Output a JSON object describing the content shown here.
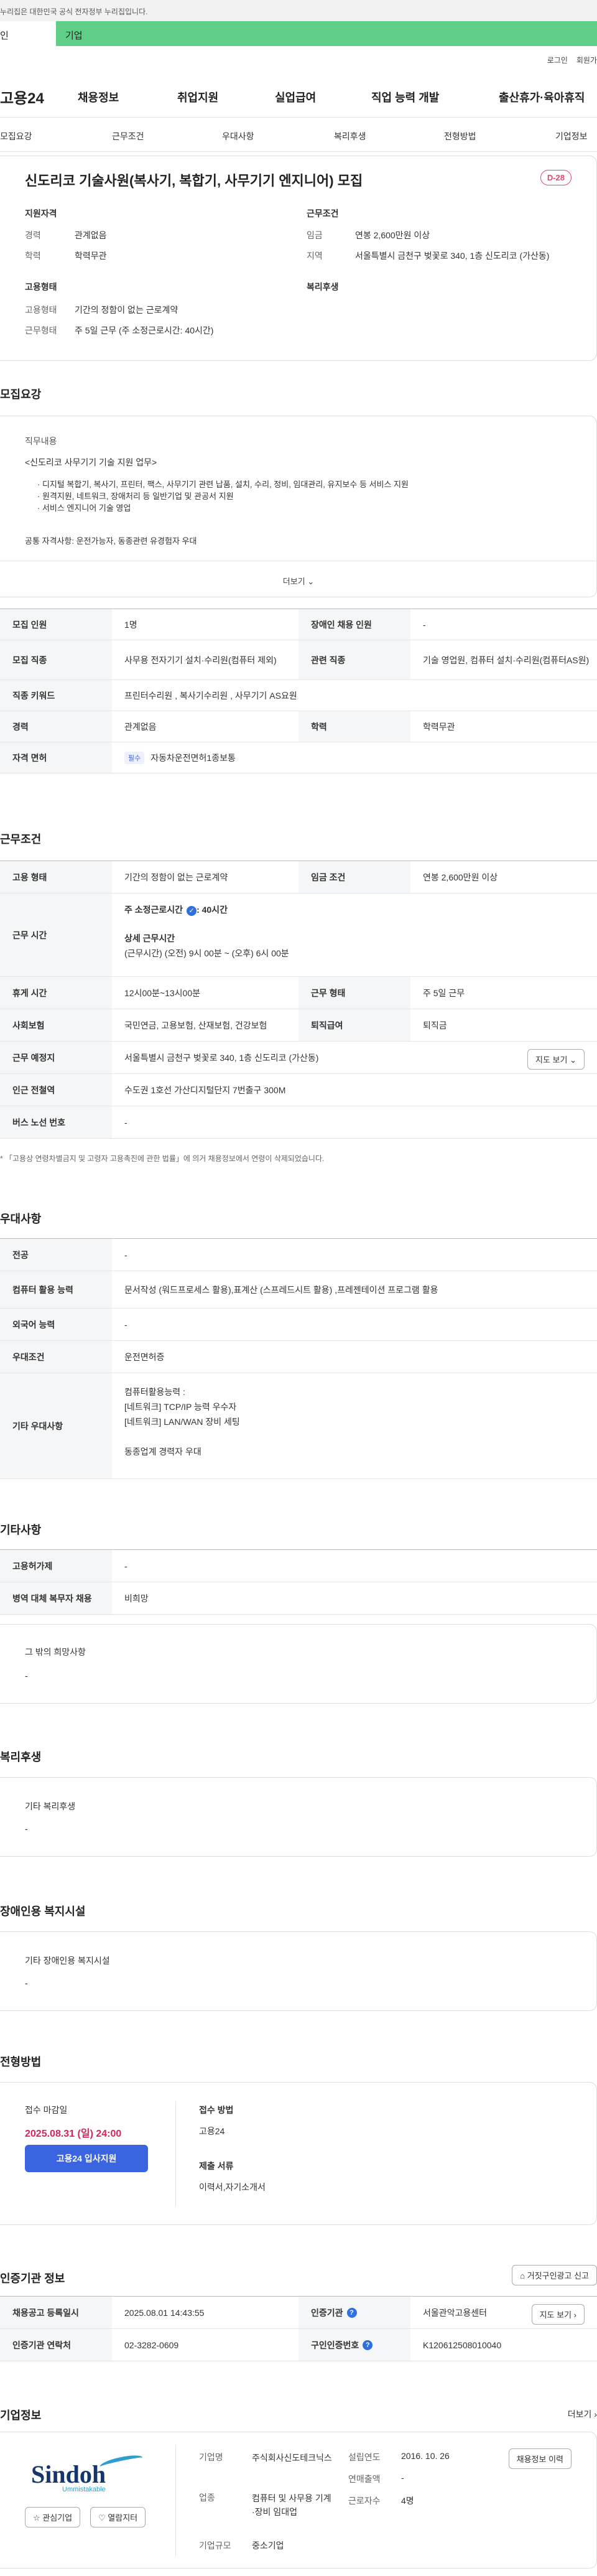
{
  "gov_banner": {
    "text": "누리집은 대한민국 공식 전자정부 누리집입니다."
  },
  "mode_tabs": {
    "person": "인",
    "corp": "기업"
  },
  "util_links": [
    "로그인",
    "회원가"
  ],
  "logo": "고용24",
  "gnb": [
    "채용정보",
    "취업지원",
    "실업급여",
    "직업 능력 개발",
    "출산휴가·육아휴직"
  ],
  "sub_nav": [
    "모집요강",
    "근무조건",
    "우대사항",
    "복리후생",
    "전형방법",
    "기업정보"
  ],
  "job": {
    "title": "신도리코 기술사원(복사기, 복합기, 사무기기 엔지니어) 모집",
    "dday": "D-28",
    "summary": {
      "qualification_title": "지원자격",
      "career_key": "경력",
      "career_val": "관계없음",
      "edu_key": "학력",
      "edu_val": "학력무관",
      "employment_title": "고용형태",
      "emp_type_key": "고용형태",
      "emp_type_val": "기간의 정함이 없는 근로계약",
      "work_type_key": "근무형태",
      "work_type_val": "주 5일 근무 (주 소정근로시간: 40시간)",
      "conditions_title": "근무조건",
      "wage_key": "임금",
      "wage_val": "연봉 2,600만원 이상",
      "region_key": "지역",
      "region_val": "서울특별시 금천구 벚꽃로 340, 1층 신도리코 (가산동)",
      "welfare_title": "복리후생"
    }
  },
  "recruit": {
    "section_title": "모집요강",
    "duty_label": "직무내용",
    "duty_header": "<신도리코 사무기기 기술 지원 업무>",
    "duty_items": [
      "· 디지털 복합기, 복사기, 프린터, 팩스, 사무기기 관련 납품, 설치, 수리, 정비, 임대관리, 유지보수 등 서비스 지원",
      "· 원격지원, 네트워크, 장애처리 등 일반기업 및 관공서 지원",
      "· 서비스 엔지니어 기술 영업"
    ],
    "duty_extra": "공통 자격사항: 운전가능자, 동종관련 유경험자 우대",
    "more_label": "더보기",
    "rows": {
      "headcount_key": "모집 인원",
      "headcount_val": "1명",
      "disabled_key": "장애인 채용 인원",
      "disabled_val": "-",
      "job_key": "모집 직종",
      "job_val": "사무용 전자기기 설치·수리원(컴퓨터 제외)",
      "related_key": "관련 직종",
      "related_val": "기술 영업원, 컴퓨터 설치·수리원(컴퓨터AS원)",
      "keyword_key": "직종 키워드",
      "keyword_val": "프린터수리원 , 복사기수리원 , 사무기기 AS요원",
      "career_key": "경력",
      "career_val": "관계없음",
      "edu_key": "학력",
      "edu_val": "학력무관",
      "license_key": "자격 면허",
      "license_badge": "필수",
      "license_val": "자동차운전면허1종보통"
    }
  },
  "conditions": {
    "section_title": "근무조건",
    "emp_key": "고용 형태",
    "emp_val": "기간의 정함이 없는 근로계약",
    "wage_key": "임금 조건",
    "wage_val": "연봉 2,600만원 이상",
    "hours_key": "근무 시간",
    "hours_line1": "주 소정근로시간",
    "hours_line1b": ": 40시간",
    "hours_detail_title": "상세 근무시간",
    "hours_detail": "(근무시간) (오전) 9시 00분 ~ (오후) 6시 00분",
    "break_key": "휴게 시간",
    "break_val": "12시00분~13시00분",
    "worktype_key": "근무 형태",
    "worktype_val": "주 5일 근무",
    "insurance_key": "사회보험",
    "insurance_val": "국민연금, 고용보험, 산재보험, 건강보험",
    "retire_key": "퇴직급여",
    "retire_val": "퇴직금",
    "location_key": "근무 예정지",
    "location_val": "서울특별시 금천구 벚꽃로 340, 1층 신도리코 (가산동)",
    "map_btn": "지도 보기",
    "subway_key": "인근 전철역",
    "subway_val": "수도권 1호선 가산디지털단지 7번출구 300M",
    "bus_key": "버스 노선 번호",
    "bus_val": "-",
    "note": "* 「고용상 연령차별금지 및 고령자 고용촉진에 관한 법률」에 의거 채용정보에서 연령이 삭제되었습니다."
  },
  "preference": {
    "section_title": "우대사항",
    "major_key": "전공",
    "major_val": "-",
    "computer_key": "컴퓨터 활용 능력",
    "computer_val": "문서작성 (워드프로세스 활용),표계산 (스프레드시트 활용) ,프레젠테이션 프로그램 활용",
    "lang_key": "외국어 능력",
    "lang_val": "-",
    "cond_key": "우대조건",
    "cond_val": "운전면허증",
    "other_key": "기타 우대사항",
    "other_lines": [
      "컴퓨터활용능력 :",
      "[네트워크] TCP/IP 능력 우수자",
      "[네트워크] LAN/WAN 장비 세팅",
      "",
      "동종업계 경력자 우대"
    ]
  },
  "etc": {
    "section_title": "기타사항",
    "employ_key": "고용허가제",
    "employ_val": "-",
    "military_key": "병역 대체 복무자 채용",
    "military_val": "비희망",
    "other_title": "그 밖의 희망사항",
    "other_val": "-"
  },
  "welfare": {
    "section_title": "복리후생",
    "label": "기타 복리후생",
    "val": "-"
  },
  "disability": {
    "section_title": "장애인용 복지시설",
    "label": "기타 장애인용 복지시설",
    "val": "-"
  },
  "selection": {
    "section_title": "전형방법",
    "deadline_label": "접수 마감일",
    "deadline": "2025.08.31 (일) 24:00",
    "apply_btn": "고용24 입사지원",
    "method_label": "접수 방법",
    "method_val": "고용24",
    "docs_label": "제출 서류",
    "docs_val": "이력서,자기소개서"
  },
  "cert": {
    "section_title": "인증기관 정보",
    "report_btn": "거짓구인광고 신고",
    "reg_key": "채용공고 등록일시",
    "reg_val": "2025.08.01 14:43:55",
    "agency_key": "인증기관",
    "agency_val": "서울관악고용센터",
    "map_btn": "지도 보기",
    "phone_key": "인증기관 연락처",
    "phone_val": "02-3282-0609",
    "id_key": "구인인증번호",
    "id_val": "K120612508010040"
  },
  "company": {
    "section_title": "기업정보",
    "more": "더보기",
    "logo_text": "Sindoh",
    "logo_sub": "Ummistakable",
    "interest_btn": "관심기업",
    "follow_btn": "열람지터",
    "type_key": "기업명",
    "type_val": "주식회사신도테크닉스",
    "industry_key": "업종",
    "industry_val": "컴퓨터 및 사무용 기계·장비 임대업",
    "size_key": "기업규모",
    "size_val": "중소기업",
    "founded_key": "설립연도",
    "founded_val": "2016. 10. 26",
    "sales_key": "연매출액",
    "sales_val": "-",
    "emp_key": "근로자수",
    "emp_val": "4명",
    "job_btn": "채용정보 이력"
  },
  "colors": {
    "brand_green": "#5fcf88",
    "accent_blue": "#3a64e0",
    "dday_red": "#e5486d",
    "deadline_red": "#d6245a"
  }
}
